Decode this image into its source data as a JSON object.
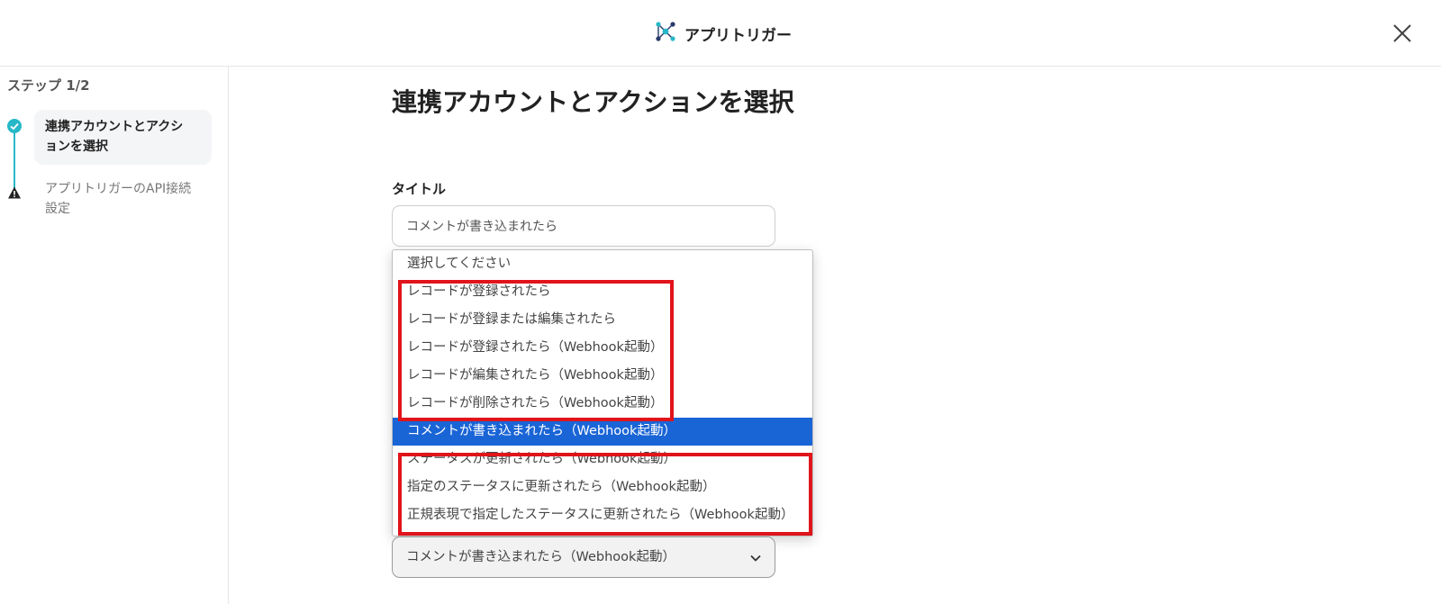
{
  "header": {
    "app_title": "アプリトリガー",
    "app_icon": "network-nodes-icon",
    "close_icon": "close-icon"
  },
  "sidebar": {
    "step_label": "ステップ 1/2",
    "steps": [
      {
        "label_line1": "連携アカウントとアクシ",
        "label_line2": "ョンを選択",
        "status": "done"
      },
      {
        "label_line1": "アプリトリガーのAPI接続",
        "label_line2": "設定",
        "status": "warning"
      }
    ]
  },
  "main": {
    "heading": "連携アカウントとアクションを選択",
    "title_field": {
      "label": "タイトル",
      "value": "コメントが書き込まれたら"
    },
    "action_select": {
      "selected_value": "コメントが書き込まれたら（Webhook起動）",
      "options": [
        "選択してください",
        "レコードが登録されたら",
        "レコードが登録または編集されたら",
        "レコードが登録されたら（Webhook起動）",
        "レコードが編集されたら（Webhook起動）",
        "レコードが削除されたら（Webhook起動）",
        "コメントが書き込まれたら（Webhook起動）",
        "ステータスが更新されたら（Webhook起動）",
        "指定のステータスに更新されたら（Webhook起動）",
        "正規表現で指定したステータスに更新されたら（Webhook起動）"
      ],
      "selected_index": 6
    }
  },
  "colors": {
    "accent_teal": "#27b8c8",
    "selection_blue": "#1a65d6",
    "highlight_red": "#e0141a"
  }
}
